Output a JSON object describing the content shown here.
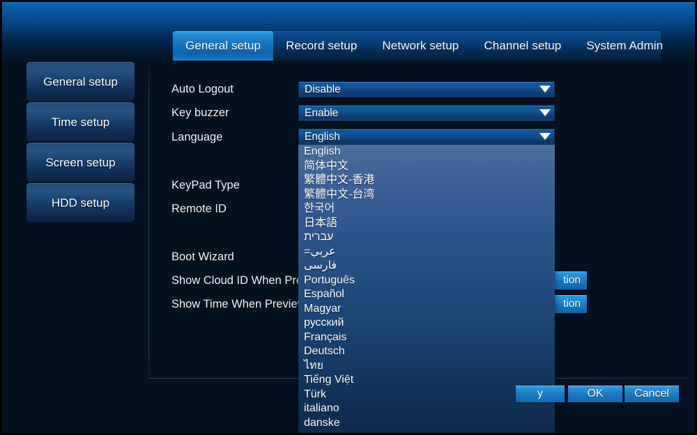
{
  "window": {
    "title": "General setup"
  },
  "tabs": [
    {
      "label": "General setup",
      "active": true
    },
    {
      "label": "Record setup",
      "active": false
    },
    {
      "label": "Network setup",
      "active": false
    },
    {
      "label": "Channel setup",
      "active": false
    },
    {
      "label": "System Admin",
      "active": false
    }
  ],
  "sidebar": {
    "items": [
      {
        "label": "General setup"
      },
      {
        "label": "Time setup"
      },
      {
        "label": "Screen setup"
      },
      {
        "label": "HDD setup"
      }
    ]
  },
  "form": {
    "rows": [
      {
        "label": "Auto Logout",
        "value": "Disable"
      },
      {
        "label": "Key buzzer",
        "value": "Enable"
      },
      {
        "label": "Language",
        "value": "English"
      },
      {
        "label": "KeyPad Type",
        "value": ""
      },
      {
        "label": "Remote ID",
        "value": ""
      },
      {
        "label": "Boot Wizard",
        "value": ""
      },
      {
        "label": "Show Cloud ID When Preview",
        "value": ""
      },
      {
        "label": "Show Time When Preview",
        "value": ""
      }
    ],
    "position_buttons": [
      {
        "label": "tion"
      },
      {
        "label": "tion"
      }
    ]
  },
  "dropdown": {
    "open": true,
    "selected": "English",
    "options": [
      {
        "label": "English",
        "rtl": false
      },
      {
        "label": "简体中文",
        "rtl": false
      },
      {
        "label": "繁體中文-香港",
        "rtl": false
      },
      {
        "label": "繁體中文-台湾",
        "rtl": false
      },
      {
        "label": "한국어",
        "rtl": false
      },
      {
        "label": "日本語",
        "rtl": false
      },
      {
        "label": "עברית",
        "rtl": true
      },
      {
        "label": "عربي=",
        "rtl": true
      },
      {
        "label": "فارسی",
        "rtl": true
      },
      {
        "label": "Português",
        "rtl": false
      },
      {
        "label": "Español",
        "rtl": false
      },
      {
        "label": "Magyar",
        "rtl": false
      },
      {
        "label": "русский",
        "rtl": false
      },
      {
        "label": "Français",
        "rtl": false
      },
      {
        "label": "Deutsch",
        "rtl": false
      },
      {
        "label": "ไทย",
        "rtl": false
      },
      {
        "label": "Tiếng Việt",
        "rtl": false
      },
      {
        "label": "Türk",
        "rtl": false
      },
      {
        "label": "italiano",
        "rtl": false
      },
      {
        "label": "danske",
        "rtl": false
      }
    ]
  },
  "actions": [
    {
      "label": "y",
      "name": "apply-button"
    },
    {
      "label": "OK",
      "name": "ok-button"
    },
    {
      "label": "Cancel",
      "name": "cancel-button"
    }
  ],
  "icons": {
    "dropdown_arrow": "chevron-down-icon"
  },
  "colors": {
    "background": "#04121f",
    "header_blue": "#0b64b4",
    "accent_blue": "#1f87d3",
    "active_tab": "#1f86d2",
    "dropdown_top": "#4a6f9c",
    "dropdown_bottom": "#0d2a4a",
    "text": "#ffffff"
  }
}
